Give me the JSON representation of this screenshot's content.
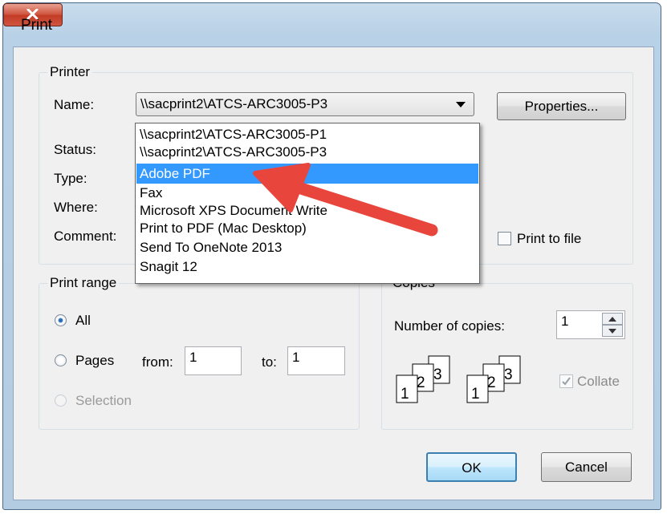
{
  "window": {
    "title": "Print",
    "close_glyph": "X"
  },
  "printer": {
    "legend": "Printer",
    "name_label": "Name:",
    "selected_printer": "\\\\sacprint2\\ATCS-ARC3005-P3",
    "properties_button": "Properties...",
    "status_label": "Status:",
    "type_label": "Type:",
    "where_label": "Where:",
    "comment_label": "Comment:",
    "print_to_file_label": "Print to file",
    "print_to_file_checked": false,
    "options": [
      "\\\\sacprint2\\ATCS-ARC3005-P1",
      "\\\\sacprint2\\ATCS-ARC3005-P3",
      "Adobe PDF",
      "Fax",
      "Microsoft XPS Document Write",
      "Print to PDF (Mac Desktop)",
      "Send To OneNote 2013",
      "Snagit 12"
    ],
    "highlighted_option": "Adobe PDF"
  },
  "print_range": {
    "legend": "Print range",
    "all_label": "All",
    "pages_label": "Pages",
    "from_label": "from:",
    "from_value": "1",
    "to_label": "to:",
    "to_value": "1",
    "selection_label": "Selection",
    "selected": "All"
  },
  "copies": {
    "legend": "Copies",
    "number_label": "Number of copies:",
    "number_value": "1",
    "collate_label": "Collate",
    "collate_checked": true,
    "collate_icon_pages": [
      "1",
      "2",
      "3"
    ]
  },
  "buttons": {
    "ok": "OK",
    "cancel": "Cancel"
  },
  "colors": {
    "highlight": "#3399ff",
    "arrow": "#e8453c",
    "close": "#c94a34"
  },
  "icons": [
    "close-icon",
    "dropdown-arrow-icon",
    "spin-up-icon",
    "spin-down-icon",
    "collate-pages-icon",
    "arrow-annotation"
  ]
}
